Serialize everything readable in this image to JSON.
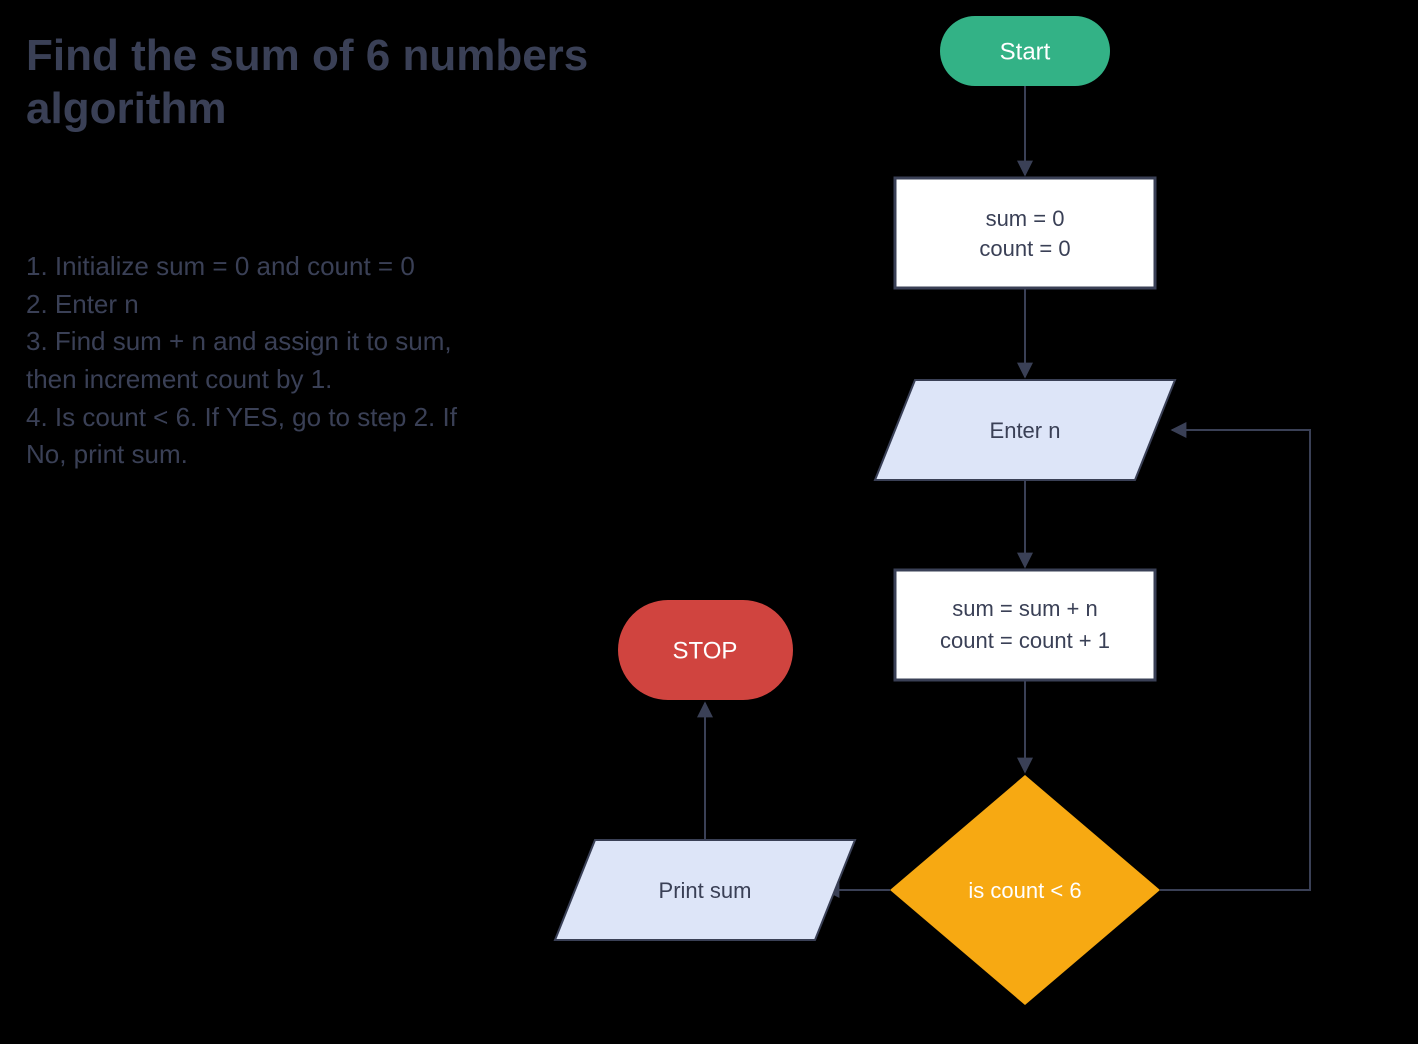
{
  "title_line1": "Find the sum of 6 numbers",
  "title_line2": "algorithm",
  "steps": {
    "s1": "1. Initialize sum = 0 and count = 0",
    "s2": "2. Enter n",
    "s3a": "3. Find sum + n and assign it to sum,",
    "s3b": "then increment count by 1.",
    "s4a": "4. Is count < 6. If YES, go to step 2. If",
    "s4b": "No, print sum."
  },
  "nodes": {
    "start": "Start",
    "init_l1": "sum = 0",
    "init_l2": "count = 0",
    "enter": "Enter n",
    "update_l1": "sum = sum + n",
    "update_l2": "count = count + 1",
    "decision": "is count < 6",
    "print": "Print sum",
    "stop": "STOP"
  },
  "colors": {
    "start_fill": "#33b286",
    "stop_fill": "#d0443f",
    "decision_fill": "#f7a912",
    "io_fill": "#dde5f8",
    "process_fill": "#ffffff",
    "stroke": "#3a4056",
    "text": "#3a4056"
  }
}
